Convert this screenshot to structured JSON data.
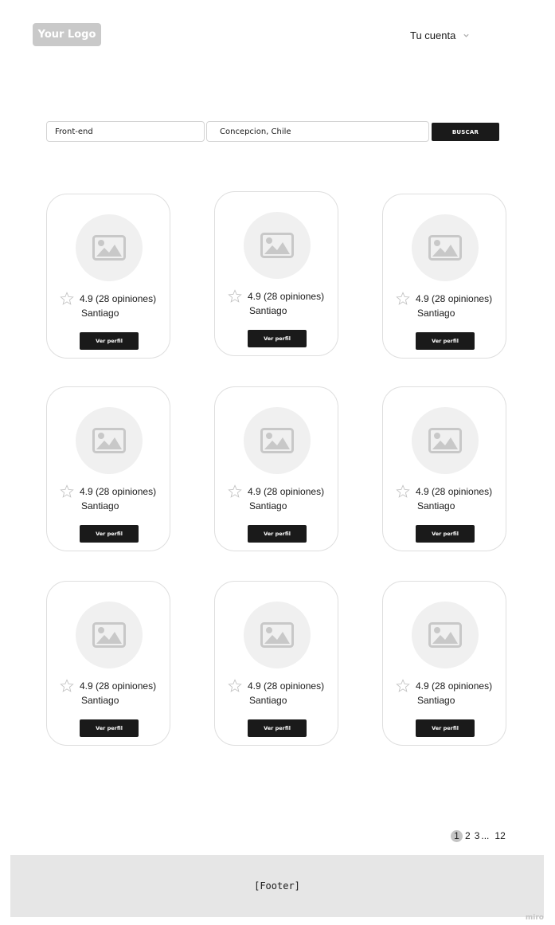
{
  "header": {
    "logo_text": "Your Logo",
    "account_label": "Tu cuenta",
    "account_icon": "chevron-down-icon"
  },
  "search": {
    "role_value": "Front-end",
    "location_value": "Concepcion, Chile",
    "button_label": "BUSCAR"
  },
  "cards": [
    {
      "rating": "4.9 (28 opiniones)",
      "city": "Santiago",
      "button": "Ver perfil"
    },
    {
      "rating": "4.9 (28 opiniones)",
      "city": "Santiago",
      "button": "Ver perfil"
    },
    {
      "rating": "4.9 (28 opiniones)",
      "city": "Santiago",
      "button": "Ver perfil"
    },
    {
      "rating": "4.9 (28 opiniones)",
      "city": "Santiago",
      "button": "Ver perfil"
    },
    {
      "rating": "4.9 (28 opiniones)",
      "city": "Santiago",
      "button": "Ver perfil"
    },
    {
      "rating": "4.9 (28 opiniones)",
      "city": "Santiago",
      "button": "Ver perfil"
    },
    {
      "rating": "4.9 (28 opiniones)",
      "city": "Santiago",
      "button": "Ver perfil"
    },
    {
      "rating": "4.9 (28 opiniones)",
      "city": "Santiago",
      "button": "Ver perfil"
    },
    {
      "rating": "4.9 (28 opiniones)",
      "city": "Santiago",
      "button": "Ver perfil"
    }
  ],
  "card_icons": {
    "avatar": "image-placeholder-icon",
    "rating": "star-icon"
  },
  "pagination": {
    "current": "1",
    "page_2": "2",
    "page_3": "3",
    "ellipsis": "...",
    "last": "12"
  },
  "footer": {
    "text": "[Footer]"
  },
  "watermark": "miro",
  "colors": {
    "primary_button": "#1a1a1a",
    "placeholder_gray": "#c9c9c9",
    "avatar_bg": "#f0f0f0",
    "footer_bg": "#e6e6e6"
  }
}
